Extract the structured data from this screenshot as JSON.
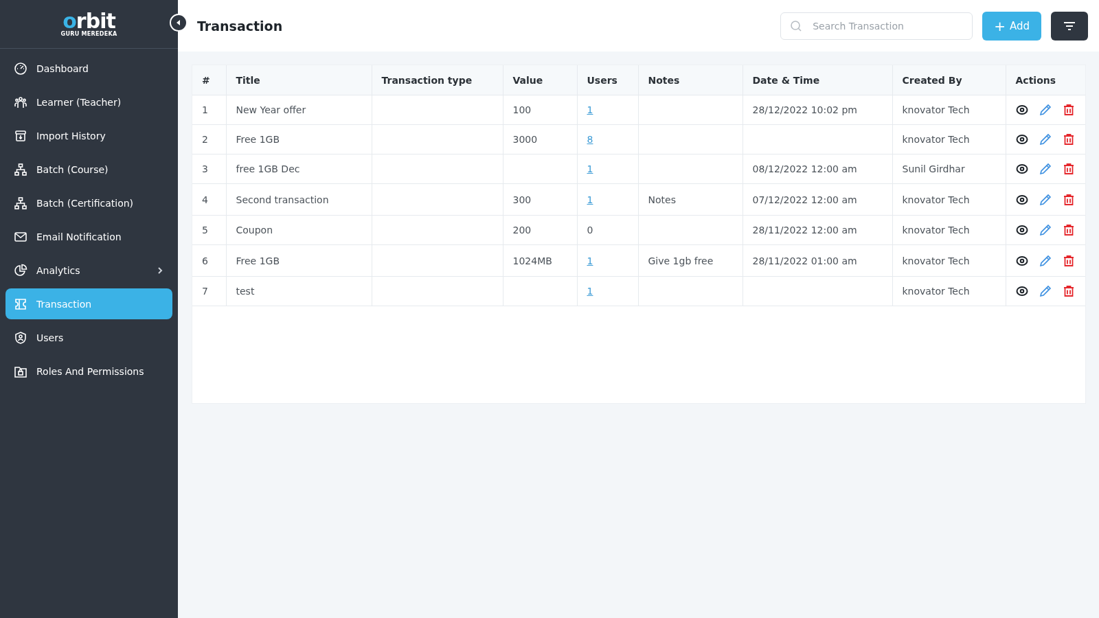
{
  "logo": {
    "word": "orbit",
    "tagline": "GURU MEREDEKA"
  },
  "sidebar": {
    "items": [
      {
        "label": "Dashboard",
        "selected": false,
        "has_submenu": false
      },
      {
        "label": "Learner (Teacher)",
        "selected": false,
        "has_submenu": false
      },
      {
        "label": "Import History",
        "selected": false,
        "has_submenu": false
      },
      {
        "label": "Batch (Course)",
        "selected": false,
        "has_submenu": false
      },
      {
        "label": "Batch (Certification)",
        "selected": false,
        "has_submenu": false
      },
      {
        "label": "Email Notification",
        "selected": false,
        "has_submenu": false
      },
      {
        "label": "Analytics",
        "selected": false,
        "has_submenu": true
      },
      {
        "label": "Transaction",
        "selected": true,
        "has_submenu": false
      },
      {
        "label": "Users",
        "selected": false,
        "has_submenu": false
      },
      {
        "label": "Roles And Permissions",
        "selected": false,
        "has_submenu": false
      }
    ]
  },
  "header": {
    "title": "Transaction",
    "search": {
      "placeholder": "Search Transaction"
    },
    "add_button": {
      "icon": "+",
      "label": "Add"
    }
  },
  "table": {
    "columns": [
      "#",
      "Title",
      "Transaction type",
      "Value",
      "Users",
      "Notes",
      "Date & Time",
      "Created By",
      "Actions"
    ],
    "rows": [
      {
        "number": "1",
        "title": "New Year offer",
        "type": "",
        "value": "100",
        "users": "1",
        "users_link": true,
        "notes": "",
        "date": "28/12/2022 10:02 pm",
        "created_by": "knovator Tech"
      },
      {
        "number": "2",
        "title": "Free 1GB",
        "type": "",
        "value": "3000",
        "users": "8",
        "users_link": true,
        "notes": "",
        "date": "",
        "created_by": "knovator Tech"
      },
      {
        "number": "3",
        "title": "free 1GB Dec",
        "type": "",
        "value": "",
        "users": "1",
        "users_link": true,
        "notes": "",
        "date": "08/12/2022 12:00 am",
        "created_by": "Sunil Girdhar"
      },
      {
        "number": "4",
        "title": "Second transaction",
        "type": "",
        "value": "300",
        "users": "1",
        "users_link": true,
        "notes": "Notes",
        "date": "07/12/2022 12:00 am",
        "created_by": "knovator Tech"
      },
      {
        "number": "5",
        "title": "Coupon",
        "type": "",
        "value": "200",
        "users": "0",
        "users_link": false,
        "notes": "",
        "date": "28/11/2022 12:00 am",
        "created_by": "knovator Tech"
      },
      {
        "number": "6",
        "title": "Free 1GB",
        "type": "",
        "value": "1024MB",
        "users": "1",
        "users_link": true,
        "notes": "Give 1gb free",
        "date": "28/11/2022 01:00 am",
        "created_by": "knovator Tech"
      },
      {
        "number": "7",
        "title": "test",
        "type": "",
        "value": "",
        "users": "1",
        "users_link": true,
        "notes": "",
        "date": "",
        "created_by": "knovator Tech"
      }
    ]
  }
}
